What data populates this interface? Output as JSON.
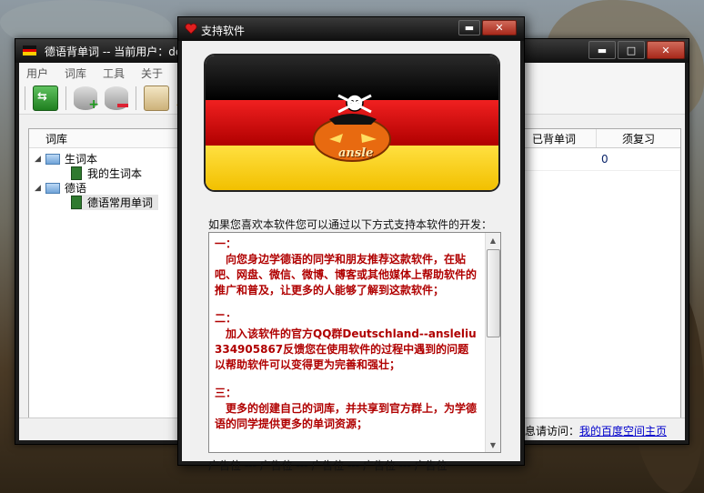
{
  "main_window": {
    "title": "德语背单词 -- 当前用户：de",
    "menu": [
      "用户",
      "词库",
      "工具",
      "关于"
    ],
    "tree": {
      "header": "词库",
      "nodes": [
        {
          "label": "生词本",
          "children": [
            "我的生词本"
          ]
        },
        {
          "label": "德语",
          "children": [
            "德语常用单词"
          ]
        }
      ]
    },
    "grid": {
      "columns": [
        "已背单词",
        "须复习"
      ],
      "row": [
        "",
        "0"
      ]
    },
    "status": {
      "prefix": "息请访问：",
      "link": "我的百度空间主页"
    }
  },
  "dialog": {
    "title": "支持软件",
    "banner_text": "ansle",
    "support_label": "如果您喜欢本软件您可以通过以下方式支持本软件的开发：",
    "paragraphs": [
      {
        "head": "一：",
        "body": "　向您身边学德语的同学和朋友推荐这款软件，在贴吧、网盘、微信、微博、博客或其他媒体上帮助软件的推广和普及，让更多的人能够了解到这款软件；"
      },
      {
        "head": "二：",
        "body": "　加入该软件的官方QQ群Deutschland--ansleliu 334905867反馈您在使用软件的过程中遇到的问题以帮助软件可以变得更为完善和强壮；"
      },
      {
        "head": "三：",
        "body": "　更多的创建自己的词库，并共享到官方群上，为学德语的同学提供更多的单词资源；"
      }
    ],
    "ads": "广告位 --- 广告位 --- 广告位 --- 广告位 --- 广告位"
  },
  "colors": {
    "flag_black": "#111111",
    "flag_red": "#dd0000",
    "flag_gold": "#ffce00",
    "text_red": "#b00000"
  }
}
